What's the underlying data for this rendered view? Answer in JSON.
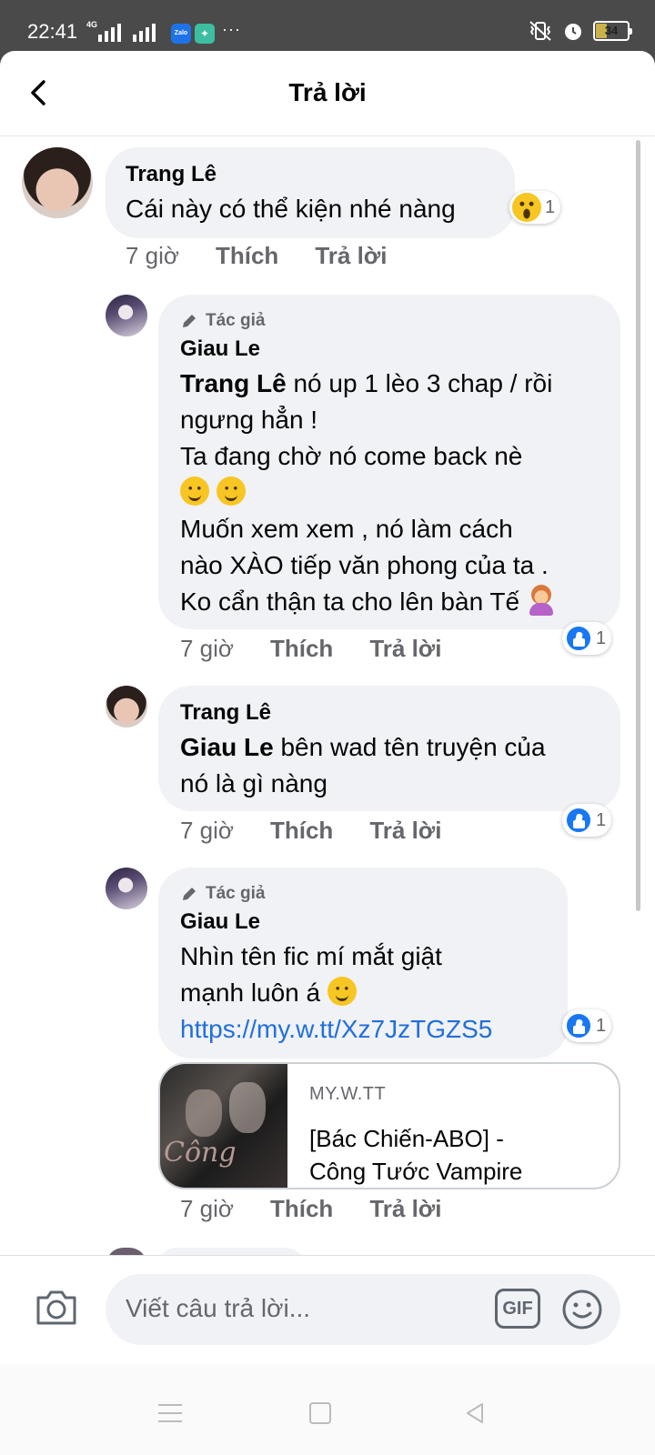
{
  "status_bar": {
    "time": "22:41",
    "network": "4G",
    "zalo_label": "Zalo",
    "more": "···",
    "battery": "34"
  },
  "header": {
    "title": "Trả lời",
    "back_icon": "chevron-left-icon"
  },
  "comments": [
    {
      "author": "Trang Lê",
      "author_tag": "",
      "text": "Cái này có thể kiện nhé nàng",
      "time": "7 giờ",
      "like_label": "Thích",
      "reply_label": "Trả lời",
      "reaction": {
        "icon": "wow-icon",
        "count": "1"
      }
    },
    {
      "author": "Giau Le",
      "author_tag": "Tác giả",
      "mention": "Trang Lê",
      "text_lines": [
        " nó up 1 lèo 3 chap / rồi",
        "ngưng hẳn !",
        "Ta đang chờ nó come back nè",
        "Muốn  xem xem ,  nó làm cách",
        "nào XÀO tiếp văn phong của ta .",
        "Ko cẩn thận ta cho lên bàn Tế"
      ],
      "time": "7 giờ",
      "like_label": "Thích",
      "reply_label": "Trả lời",
      "reaction": {
        "icon": "like-icon",
        "count": "1"
      }
    },
    {
      "author": "Trang Lê",
      "mention": "Giau Le",
      "text_lines": [
        " bên wad tên truyện của",
        "nó là gì nàng"
      ],
      "time": "7 giờ",
      "like_label": "Thích",
      "reply_label": "Trả lời",
      "reaction": {
        "icon": "like-icon",
        "count": "1"
      }
    },
    {
      "author": "Giau Le",
      "author_tag": "Tác giả",
      "text_lines": [
        "Nhìn tên fic mí mắt giật",
        "mạnh luôn á"
      ],
      "link": "https://my.w.tt/Xz7JzTGZS5",
      "preview": {
        "domain": "MY.W.TT",
        "title_line1": "[Bác Chiến-ABO] -",
        "title_line2": "Công Tước Vampire",
        "image_text": "Công"
      },
      "time": "7 giờ",
      "like_label": "Thích",
      "reply_label": "Trả lời",
      "reaction": {
        "icon": "like-icon",
        "count": "1"
      }
    }
  ],
  "composer": {
    "placeholder": "Viết câu trả lời...",
    "gif_label": "GIF",
    "camera_icon": "camera-icon",
    "emoji_icon": "smile-icon"
  },
  "colors": {
    "accent": "#1877f2",
    "link": "#216fdb",
    "bubble": "#f0f2f5",
    "secondary_text": "#65676b"
  }
}
